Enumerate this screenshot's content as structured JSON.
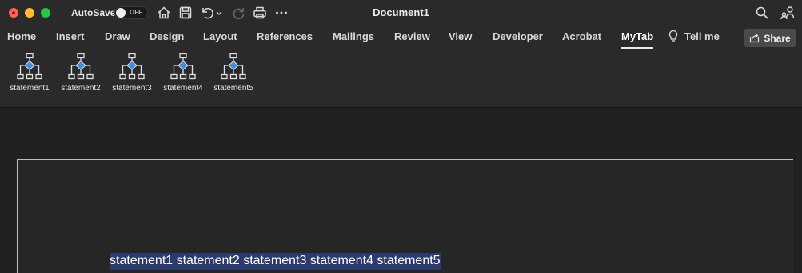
{
  "titlebar": {
    "autosave_label": "AutoSave",
    "autosave_state": "OFF",
    "document_title": "Document1",
    "icons": [
      "home-icon",
      "save-icon",
      "undo-icon",
      "undo-dropdown-icon",
      "redo-icon",
      "print-icon",
      "more-icon",
      "search-icon",
      "share-people-icon"
    ]
  },
  "tabs": [
    {
      "label": "Home"
    },
    {
      "label": "Insert"
    },
    {
      "label": "Draw"
    },
    {
      "label": "Design"
    },
    {
      "label": "Layout"
    },
    {
      "label": "References"
    },
    {
      "label": "Mailings"
    },
    {
      "label": "Review"
    },
    {
      "label": "View"
    },
    {
      "label": "Developer"
    },
    {
      "label": "Acrobat"
    },
    {
      "label": "MyTab",
      "active": true
    }
  ],
  "tell_me": "Tell me",
  "share": "Share",
  "ribbon": {
    "buttons": [
      {
        "label": "statement1",
        "icon": "flowchart-icon"
      },
      {
        "label": "statement2",
        "icon": "flowchart-icon"
      },
      {
        "label": "statement3",
        "icon": "flowchart-icon"
      },
      {
        "label": "statement4",
        "icon": "flowchart-icon"
      },
      {
        "label": "statement5",
        "icon": "flowchart-icon"
      }
    ]
  },
  "document": {
    "selected_text": "statement1 statement2 statement3 statement4 statement5"
  },
  "colors": {
    "chrome": "#2a2a2a",
    "selection": "#2c3b6e",
    "flowchart_accent": "#3d8ee0"
  }
}
